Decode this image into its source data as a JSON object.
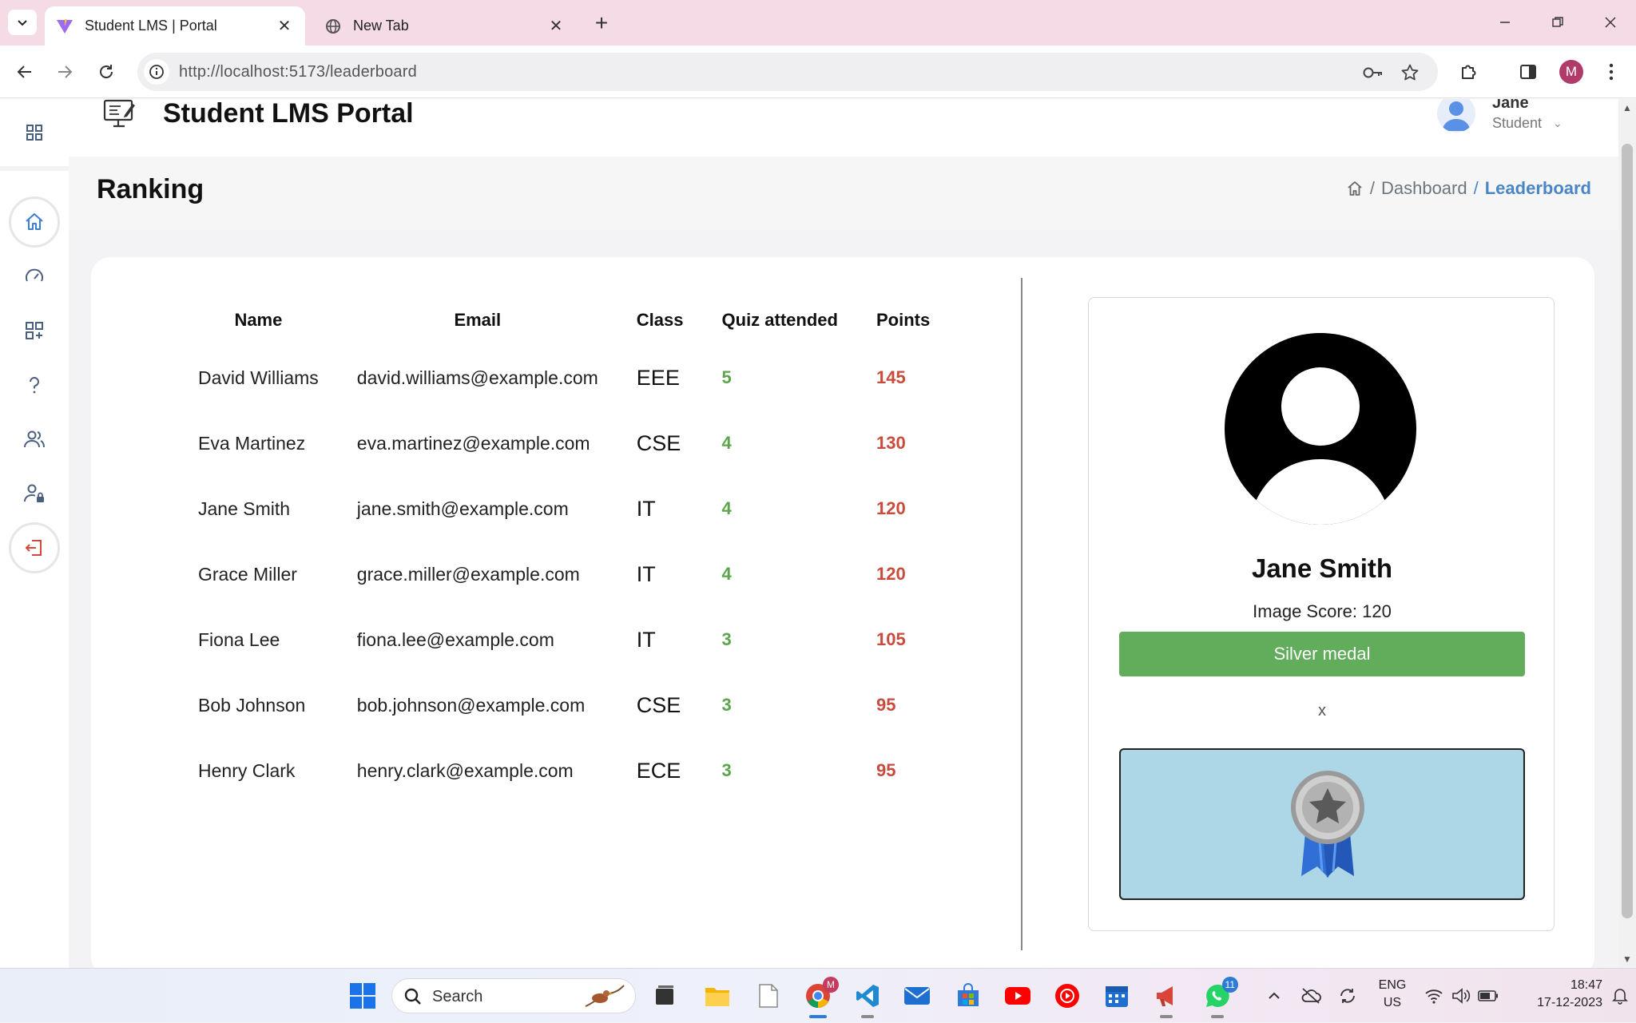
{
  "browser": {
    "tabs": [
      {
        "title": "Student LMS | Portal",
        "active": true
      },
      {
        "title": "New Tab",
        "active": false
      }
    ],
    "url": "http://localhost:5173/leaderboard",
    "profile_initial": "M"
  },
  "app": {
    "brand_title": "Student LMS Portal",
    "user": {
      "name": "Jane",
      "role": "Student"
    },
    "page_title": "Ranking",
    "breadcrumb": {
      "dashboard": "Dashboard",
      "current": "Leaderboard",
      "separator": "/"
    },
    "sidebar_icons": [
      "grid-icon",
      "home-icon",
      "speedometer-icon",
      "apps-icon",
      "question-icon",
      "users-icon",
      "user-lock-icon",
      "logout-icon"
    ]
  },
  "leaderboard": {
    "columns": [
      "Name",
      "Email",
      "Class",
      "Quiz attended",
      "Points"
    ],
    "rows": [
      {
        "name": "David Williams",
        "email": "david.williams@example.com",
        "class": "EEE",
        "quiz": "5",
        "points": "145"
      },
      {
        "name": "Eva Martinez",
        "email": "eva.martinez@example.com",
        "class": "CSE",
        "quiz": "4",
        "points": "130"
      },
      {
        "name": "Jane Smith",
        "email": "jane.smith@example.com",
        "class": "IT",
        "quiz": "4",
        "points": "120"
      },
      {
        "name": "Grace Miller",
        "email": "grace.miller@example.com",
        "class": "IT",
        "quiz": "4",
        "points": "120"
      },
      {
        "name": "Fiona Lee",
        "email": "fiona.lee@example.com",
        "class": "IT",
        "quiz": "3",
        "points": "105"
      },
      {
        "name": "Bob Johnson",
        "email": "bob.johnson@example.com",
        "class": "CSE",
        "quiz": "3",
        "points": "95"
      },
      {
        "name": "Henry Clark",
        "email": "henry.clark@example.com",
        "class": "ECE",
        "quiz": "3",
        "points": "95"
      }
    ]
  },
  "profile_card": {
    "name": "Jane Smith",
    "score_text": "Image Score: 120",
    "medal_button": "Silver medal",
    "close_label": "x"
  },
  "taskbar": {
    "search_label": "Search",
    "language": "ENG",
    "region": "US",
    "time": "18:47",
    "date": "17-12-2023",
    "chrome_badge": "M",
    "whatsapp_badge": "11"
  },
  "colors": {
    "quiz_green": "#5ba64a",
    "points_red": "#c84b3c",
    "breadcrumb_active": "#4a86c5",
    "medal_button": "#62ad5b",
    "medal_box": "#add6e6",
    "tabbar_bg": "#f5dbe5"
  }
}
